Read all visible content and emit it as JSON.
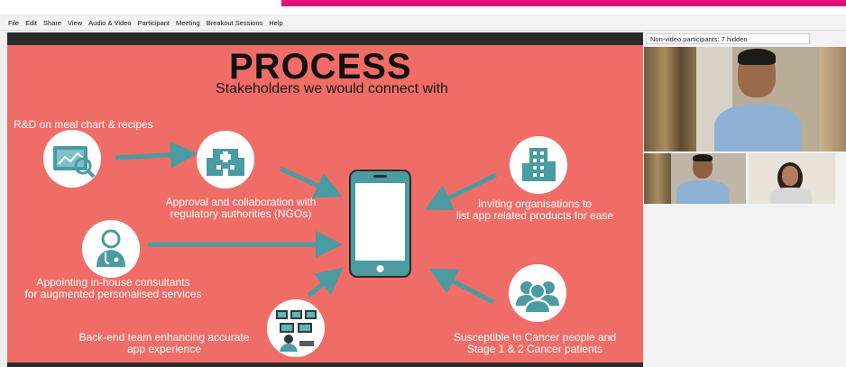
{
  "brand_color": "#e0127d",
  "slide_bg": "#f06d67",
  "icon_teal": "#4a9ba2",
  "menu": [
    "File",
    "Edit",
    "Share",
    "View",
    "Audio & Video",
    "Participant",
    "Meeting",
    "Breakout Sessions",
    "Help"
  ],
  "slide": {
    "title": "PROCESS",
    "subtitle": "Stakeholders we would connect with",
    "items": {
      "rd": "R&D on meal chart & recipes",
      "approval": [
        "Approval and collaboration with",
        "regulatory authorities (NGOs)"
      ],
      "inviting": [
        "Inviting organisations to",
        "list app related products for ease"
      ],
      "consultants": [
        "Appointing in-house consultants",
        "for augmented personalised services"
      ],
      "backend": [
        "Back-end team enhancing accurate",
        "app experience"
      ],
      "susceptible": [
        "Susceptible to Cancer people and",
        "Stage 1 & 2 Cancer patients"
      ]
    },
    "icons": [
      "recipe-chart-icon",
      "hospital-icon",
      "office-building-icon",
      "doctor-icon",
      "backend-team-icon",
      "people-group-icon",
      "smartphone-icon"
    ]
  },
  "participants": {
    "label": "Non-video participants: 7 hidden"
  }
}
